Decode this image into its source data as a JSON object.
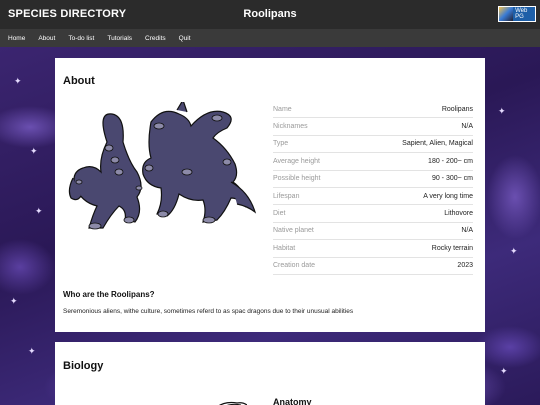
{
  "header": {
    "site_title": "SPECIES DIRECTORY",
    "page_name": "Roolipans",
    "badge_label": "Web PG"
  },
  "nav": [
    "Home",
    "About",
    "To-do list",
    "Tutorials",
    "Credits",
    "Quit"
  ],
  "about": {
    "heading": "About",
    "fields": [
      {
        "label": "Name",
        "value": "Roolipans"
      },
      {
        "label": "Nicknames",
        "value": "N/A"
      },
      {
        "label": "Type",
        "value": "Sapient, Alien, Magical"
      },
      {
        "label": "Average height",
        "value": "180 - 200~ cm"
      },
      {
        "label": "Possible height",
        "value": "90 - 300~ cm"
      },
      {
        "label": "Lifespan",
        "value": "A very long time"
      },
      {
        "label": "Diet",
        "value": "Lithovore"
      },
      {
        "label": "Native planet",
        "value": "N/A"
      },
      {
        "label": "Habitat",
        "value": "Rocky terrain"
      },
      {
        "label": "Creation date",
        "value": "2023"
      }
    ],
    "subheading": "Who are the Roolipans?",
    "description": "Seremonious aliens, withe culture, sometimes referd to as spac dragons due to their unusual abilities"
  },
  "biology": {
    "heading": "Biology",
    "subheading": "Anatomy"
  },
  "colors": {
    "creature_body": "#4a4870",
    "creature_spots": "#8c8aa8",
    "outline": "#111111"
  },
  "icons": {
    "background": "purple-starry-pattern",
    "badge": "webpg-badge-icon"
  }
}
